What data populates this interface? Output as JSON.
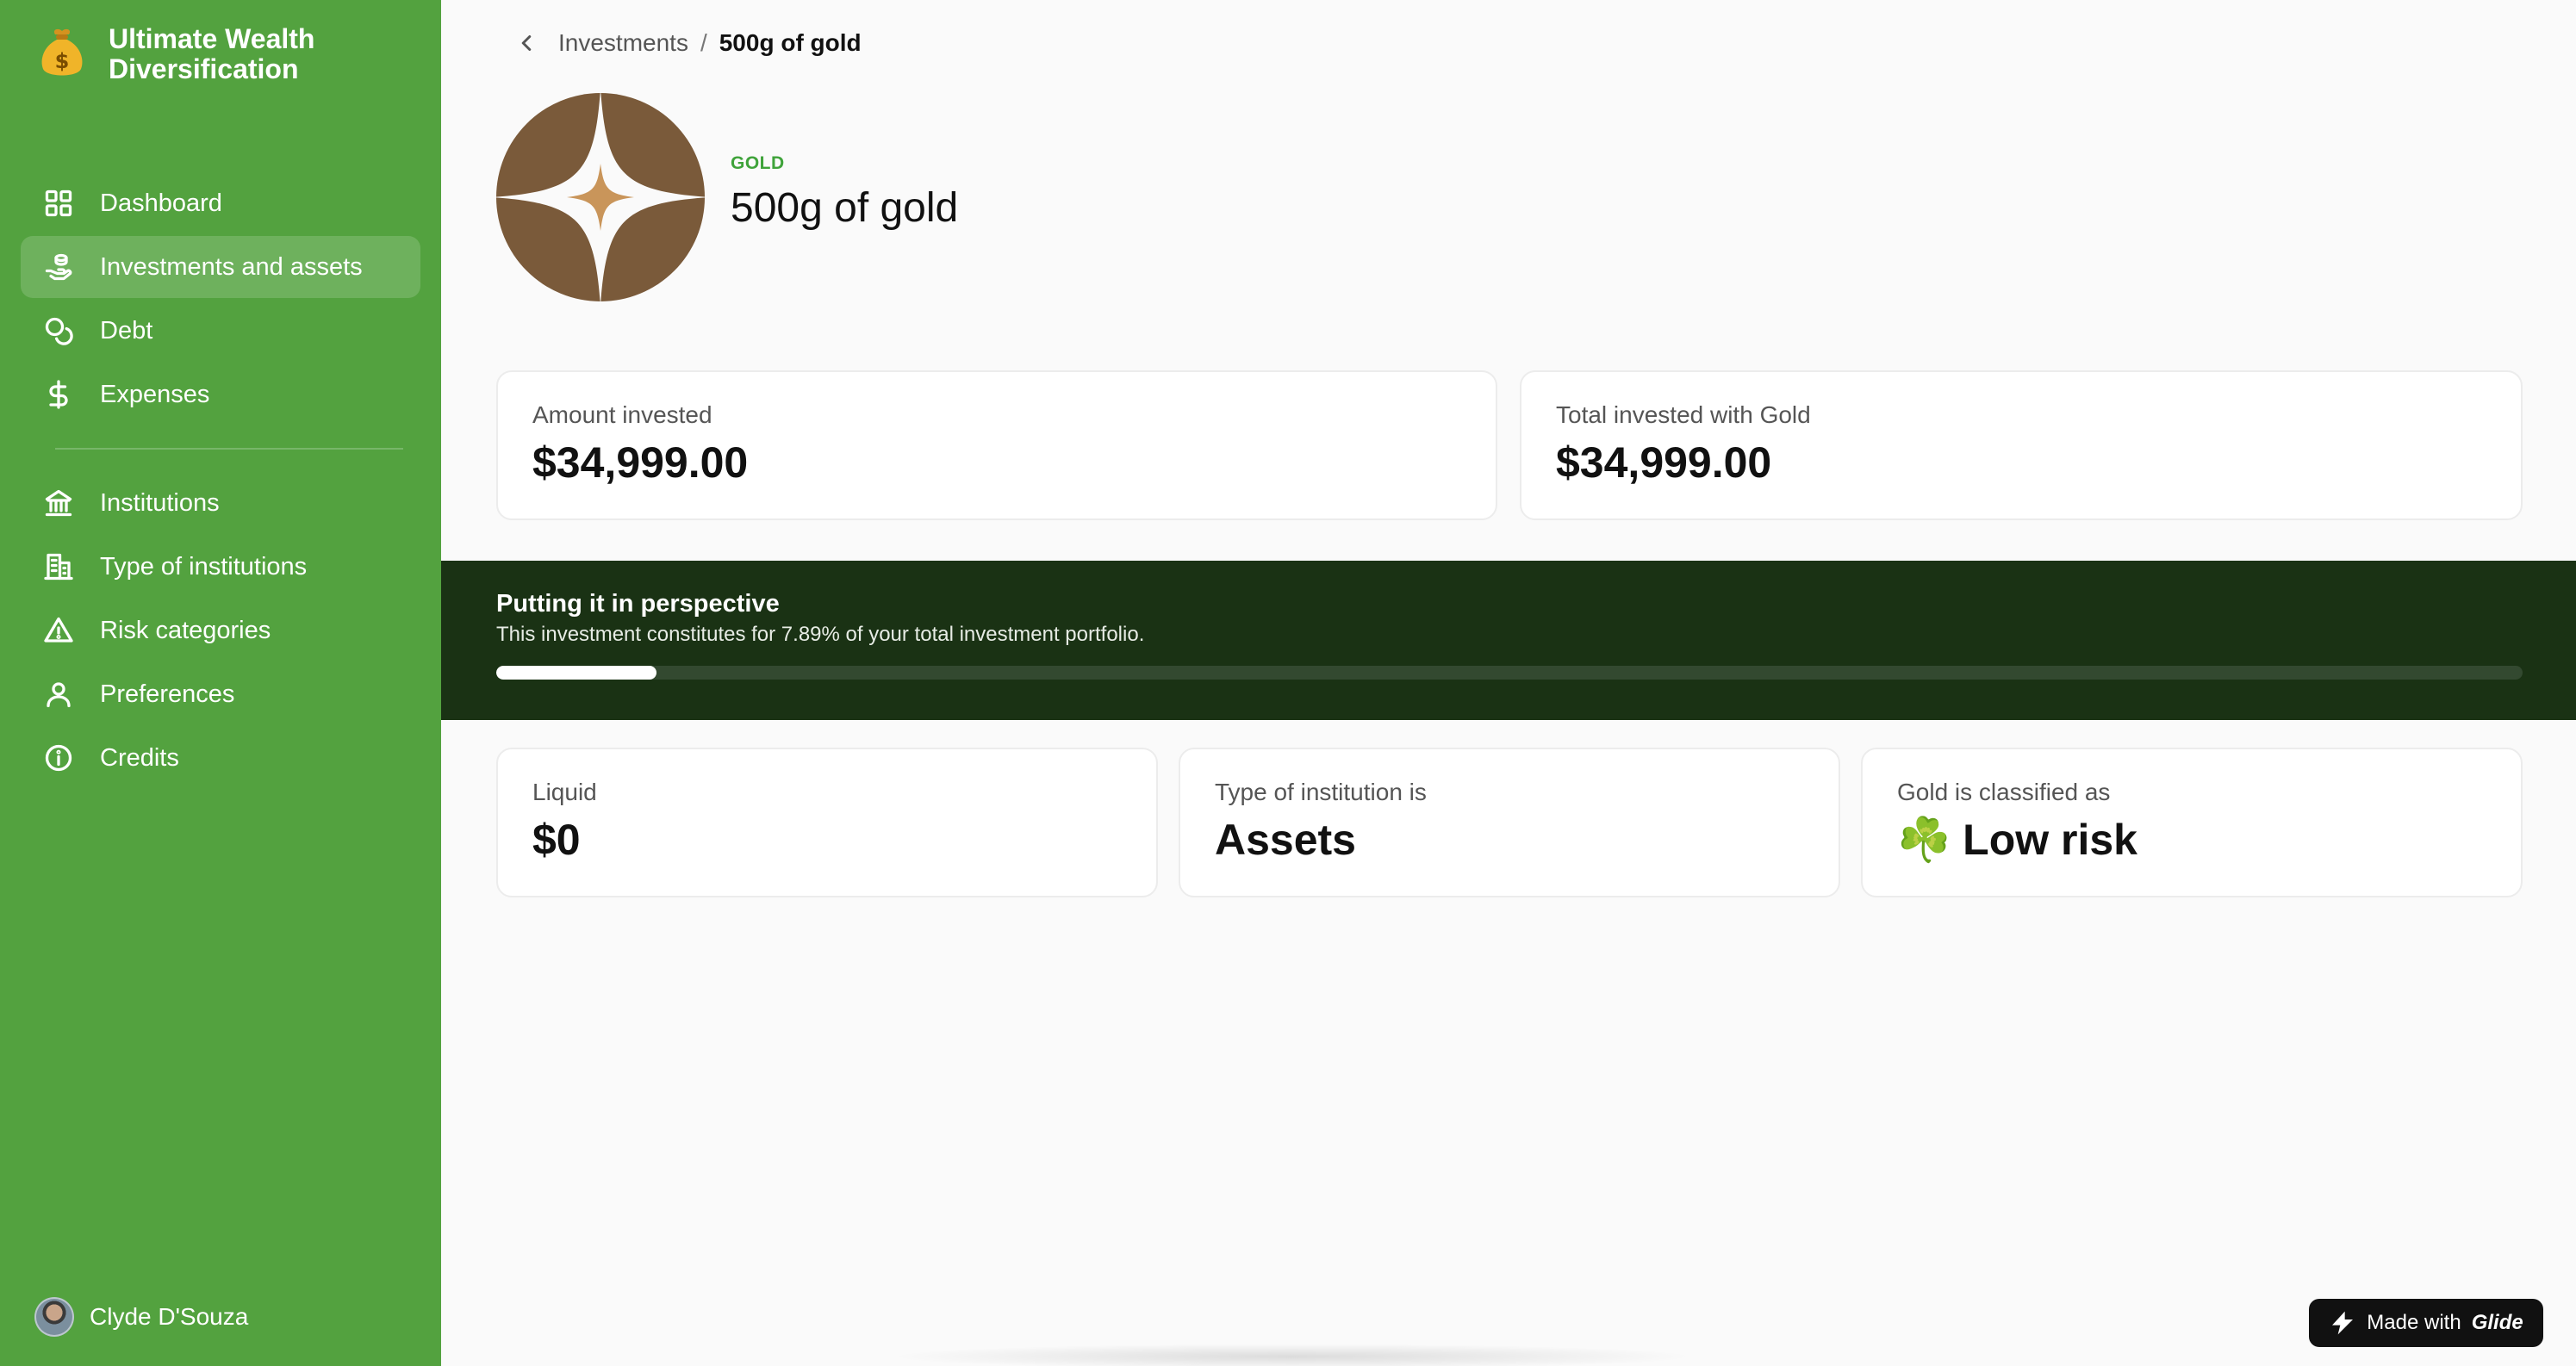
{
  "app": {
    "title": "Ultimate Wealth Diversification",
    "logo_icon": "money-bag-icon"
  },
  "sidebar": {
    "items": [
      {
        "label": "Dashboard",
        "icon": "grid-icon",
        "active": false
      },
      {
        "label": "Investments and assets",
        "icon": "coins-hand-icon",
        "active": true
      },
      {
        "label": "Debt",
        "icon": "coins-icon",
        "active": false
      },
      {
        "label": "Expenses",
        "icon": "dollar-icon",
        "active": false
      },
      {
        "label": "Institutions",
        "icon": "bank-icon",
        "active": false
      },
      {
        "label": "Type of institutions",
        "icon": "building-icon",
        "active": false
      },
      {
        "label": "Risk categories",
        "icon": "warning-icon",
        "active": false
      },
      {
        "label": "Preferences",
        "icon": "user-icon",
        "active": false
      },
      {
        "label": "Credits",
        "icon": "info-icon",
        "active": false
      }
    ],
    "user": {
      "name": "Clyde D'Souza"
    }
  },
  "breadcrumb": {
    "parent": "Investments",
    "separator": "/",
    "current": "500g of gold"
  },
  "hero": {
    "overline": "GOLD",
    "title": "500g of gold"
  },
  "summary": {
    "amount_invested": {
      "label": "Amount invested",
      "value": "$34,999.00"
    },
    "total_invested": {
      "label": "Total invested with Gold",
      "value": "$34,999.00"
    }
  },
  "perspective": {
    "title": "Putting it in perspective",
    "subtitle": "This investment constitutes for 7.89% of your total investment portfolio.",
    "progress_percent": 7.89
  },
  "details": {
    "liquid": {
      "label": "Liquid",
      "value": "$0"
    },
    "institution_type": {
      "label": "Type of institution is",
      "value": "Assets"
    },
    "risk": {
      "label": "Gold is classified as",
      "value": "☘️ Low risk"
    }
  },
  "badge": {
    "prefix": "Made with",
    "brand": "Glide"
  },
  "colors": {
    "sidebar": "#53a23f",
    "banner": "#1a3214",
    "accent": "#3fa33a",
    "gold_icon": "#7a5a3a",
    "gold_star": "#c9955a"
  }
}
